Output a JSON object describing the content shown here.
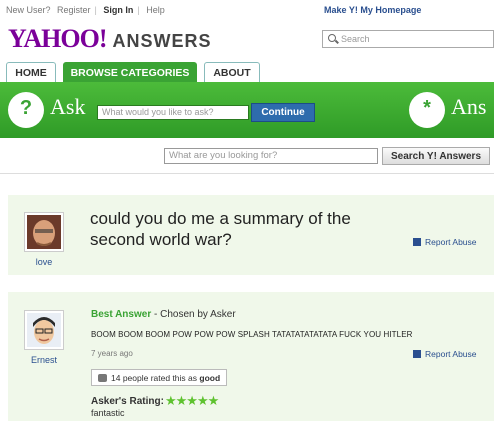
{
  "topbar": {
    "new_user": "New User?",
    "register": "Register",
    "sign_in": "Sign In",
    "help": "Help",
    "make_homepage": "Make Y! My Homepage"
  },
  "logo": {
    "yahoo": "YAHOO!",
    "answers": "ANSWERS"
  },
  "header_search": {
    "placeholder": "Search"
  },
  "tabs": [
    {
      "label": "HOME"
    },
    {
      "label": "BROWSE CATEGORIES",
      "active": true
    },
    {
      "label": "ABOUT"
    }
  ],
  "askbar": {
    "icon": "question-smiley-icon",
    "ask_label": "Ask",
    "ask_placeholder": "What would you like to ask?",
    "continue_label": "Continue",
    "answer_label": "Ans"
  },
  "search": {
    "placeholder": "What are you looking for?",
    "button_label": "Search Y! Answers"
  },
  "question": {
    "title": "could you do me a summary of the second world war?",
    "asker": "love",
    "report_label": "Report Abuse"
  },
  "best_answer": {
    "label": "Best Answer",
    "chosen_by": " - Chosen by Asker",
    "text": "BOOM BOOM BOOM POW POW POW SPLASH TATATATATATATA  FUCK YOU HITLER",
    "answerer": "Ernest",
    "age": "7 years ago",
    "report_label": "Report Abuse",
    "rated_prefix": "14 people rated this as ",
    "rated_value": "good",
    "asker_rating_label": "Asker's Rating:",
    "stars": "★★★★★",
    "asker_comment": "fantastic"
  },
  "colors": {
    "green": "#3aa334",
    "purple": "#7b0099",
    "link": "#2a4f8f"
  }
}
